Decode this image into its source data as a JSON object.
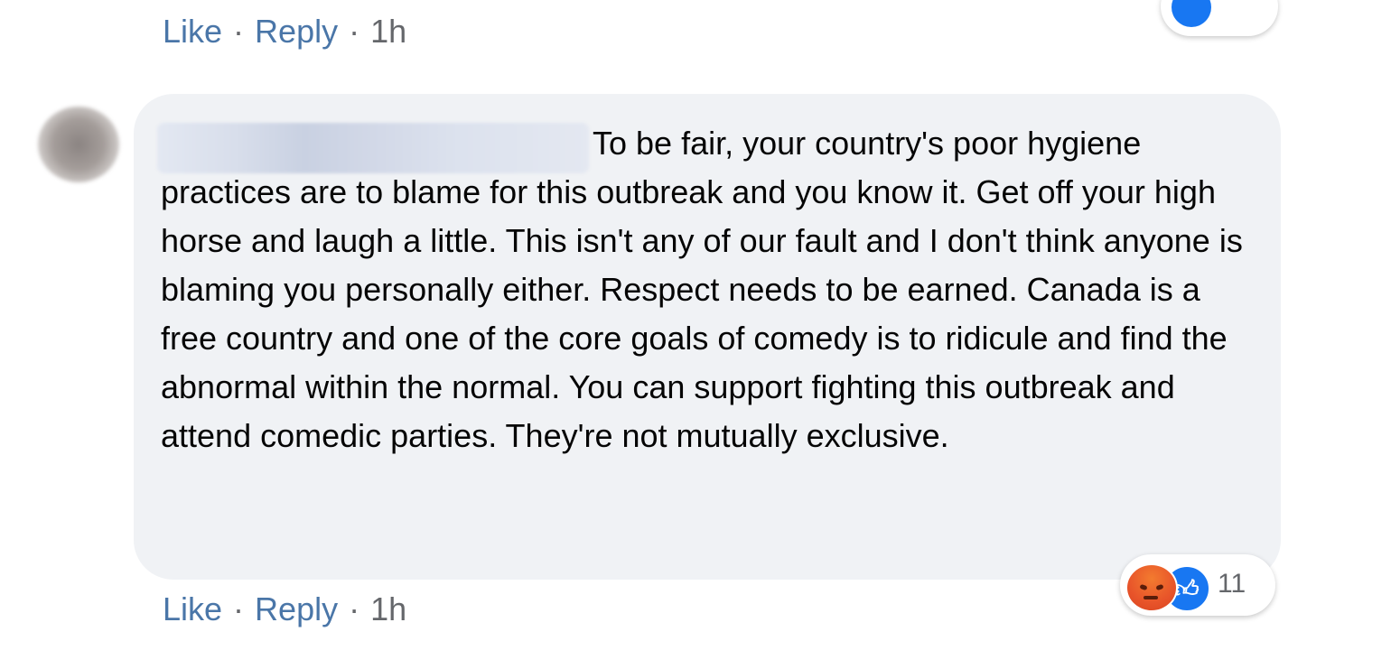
{
  "top_actions": {
    "like_label": "Like",
    "separator": "·",
    "reply_label": "Reply",
    "timestamp": "1h"
  },
  "comment": {
    "text": "To be fair, your country's poor hygiene practices are to blame for this outbreak and you know it. Get off your high horse and laugh a little. This isn't any of our fault and I don't think anyone is blaming you personally either. Respect needs to be earned. Canada is a free country and one of the core goals of comedy is to ridicule and find the abnormal within the normal. You can support fighting this outbreak and attend comedic parties. They're not mutually exclusive.",
    "reactions": {
      "icons": [
        "angry-icon",
        "like-icon"
      ],
      "count": "11"
    }
  },
  "bottom_actions": {
    "like_label": "Like",
    "separator": "·",
    "reply_label": "Reply",
    "timestamp": "1h"
  },
  "colors": {
    "bubble_bg": "#f0f2f5",
    "link": "#4a76a8",
    "muted": "#65676b",
    "like_blue": "#1877f2",
    "angry_orange": "#e8542a"
  }
}
